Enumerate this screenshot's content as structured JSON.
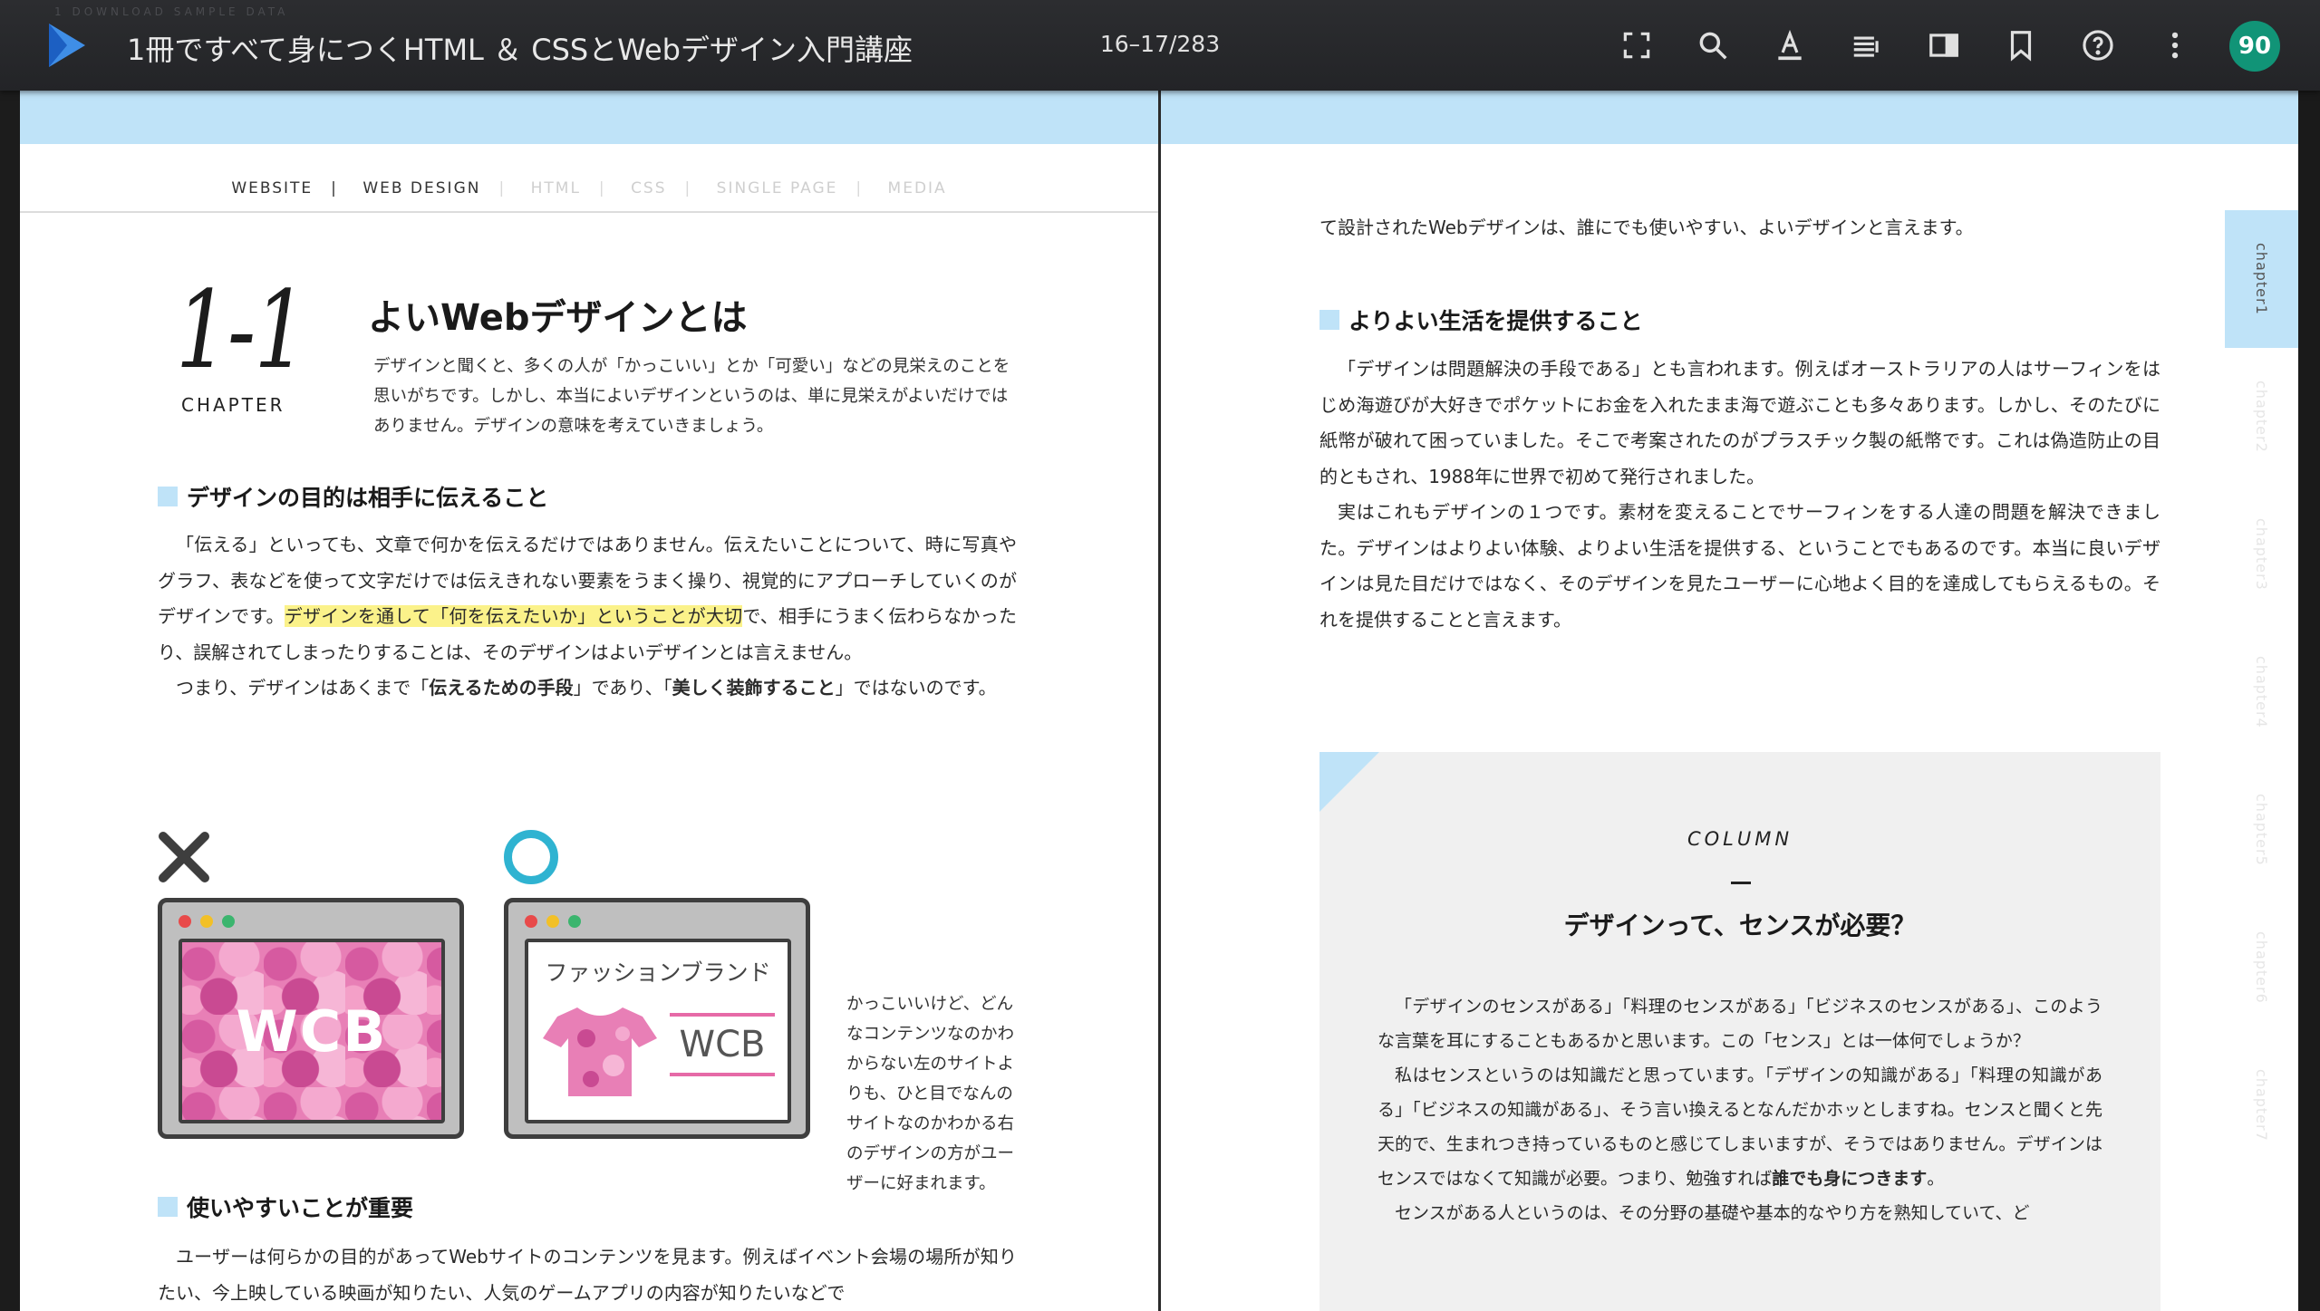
{
  "toolbar": {
    "ghost_text": "1  DOWNLOAD SAMPLE DATA",
    "book_title": "1冊ですべて身につくHTML ＆ CSSとWebデザイン入門講座",
    "page_indicator": "16–17/283",
    "icons": [
      "fullscreen-icon",
      "search-icon",
      "text-format-icon",
      "list-icon",
      "sidebar-panel-icon",
      "bookmark-icon",
      "help-icon",
      "more-vert-icon"
    ],
    "avatar_label": "90",
    "avatar_color": "#119477"
  },
  "left_page": {
    "site_nav": [
      "WEBSITE",
      "WEB DESIGN",
      "HTML",
      "CSS",
      "SINGLE PAGE",
      "MEDIA"
    ],
    "chapter_number": "1-1",
    "chapter_label": "CHAPTER",
    "section_title": "よいWebデザインとは",
    "intro": "デザインと聞くと、多くの人が「かっこいい」とか「可愛い」などの見栄えのことを思いがちです。しかし、本当によいデザインというのは、単に見栄えがよいだけではありません。デザインの意味を考えていきましょう。",
    "heading1": "デザインの目的は相手に伝えること",
    "p1_a": "「伝える」といっても、文章で何かを伝えるだけではありません。伝えたいことについて、時に写真やグラフ、表などを使って文字だけでは伝えきれない要素をうまく操り、視覚的にアプローチしていくのがデザインです。",
    "p1_highlight": "デザインを通して「何を伝えたいか」ということが大切",
    "p1_b": "で、相手にうまく伝わらなかったり、誤解されてしまったりすることは、そのデザインはよいデザインとは言えません。",
    "p2_a": "つまり、デザインはあくまで「",
    "p2_bold1": "伝えるための手段",
    "p2_b": "」であり、「",
    "p2_bold2": "美しく装飾すること",
    "p2_c": "」ではないのです。",
    "illus_bad_text": "WCB",
    "illus_brand_name": "ファッションブランド",
    "illus_brand_wcb": "WCB",
    "illus_note": "かっこいいけど、どんなコンテンツなのかわからない左のサイトよりも、ひと目でなんのサイトなのかわかる右のデザインの方がユーザーに好まれます。",
    "heading2": "使いやすいことが重要",
    "p3": "ユーザーは何らかの目的があってWebサイトのコンテンツを見ます。例えばイベント会場の場所が知りたい、今上映している映画が知りたい、人気のゲームアプリの内容が知りたいなどで"
  },
  "right_page": {
    "p0": "て設計されたWebデザインは、誰にでも使いやすい、よいデザインと言えます。",
    "heading": "よりよい生活を提供すること",
    "p1": "「デザインは問題解決の手段である」とも言われます。例えばオーストラリアの人はサーフィンをはじめ海遊びが大好きでポケットにお金を入れたまま海で遊ぶことも多々あります。しかし、そのたびに紙幣が破れて困っていました。そこで考案されたのがプラスチック製の紙幣です。これは偽造防止の目的ともされ、1988年に世界で初めて発行されました。",
    "p2": "実はこれもデザインの１つです。素材を変えることでサーフィンをする人達の問題を解決できました。デザインはよりよい体験、よりよい生活を提供する、ということでもあるのです。本当に良いデザインは見た目だけではなく、そのデザインを見たユーザーに心地よく目的を達成してもらえるもの。それを提供することと言えます。",
    "column_label": "COLUMN",
    "column_title": "デザインって、センスが必要？",
    "column_p1": "「デザインのセンスがある」「料理のセンスがある」「ビジネスのセンスがある」、このような言葉を耳にすることもあるかと思います。この「センス」とは一体何でしょうか？",
    "column_p2_a": "私はセンスというのは知識だと思っています。「デザインの知識がある」「料理の知識がある」「ビジネスの知識がある」、そう言い換えるとなんだかホッとしますね。センスと聞くと先天的で、生まれつき持っているものと感じてしまいますが、そうではありません。デザインはセンスではなくて知識が必要。つまり、勉強すれば",
    "column_p2_bold": "誰でも身につきます",
    "column_p2_b": "。",
    "column_p3": "センスがある人というのは、その分野の基礎や基本的なやり方を熟知していて、ど",
    "side_tabs": [
      "chapter1",
      "chapter2",
      "chapter3",
      "chapter4",
      "chapter5",
      "chapter6",
      "chapter7"
    ],
    "accent_color": "#bfe3f8"
  }
}
